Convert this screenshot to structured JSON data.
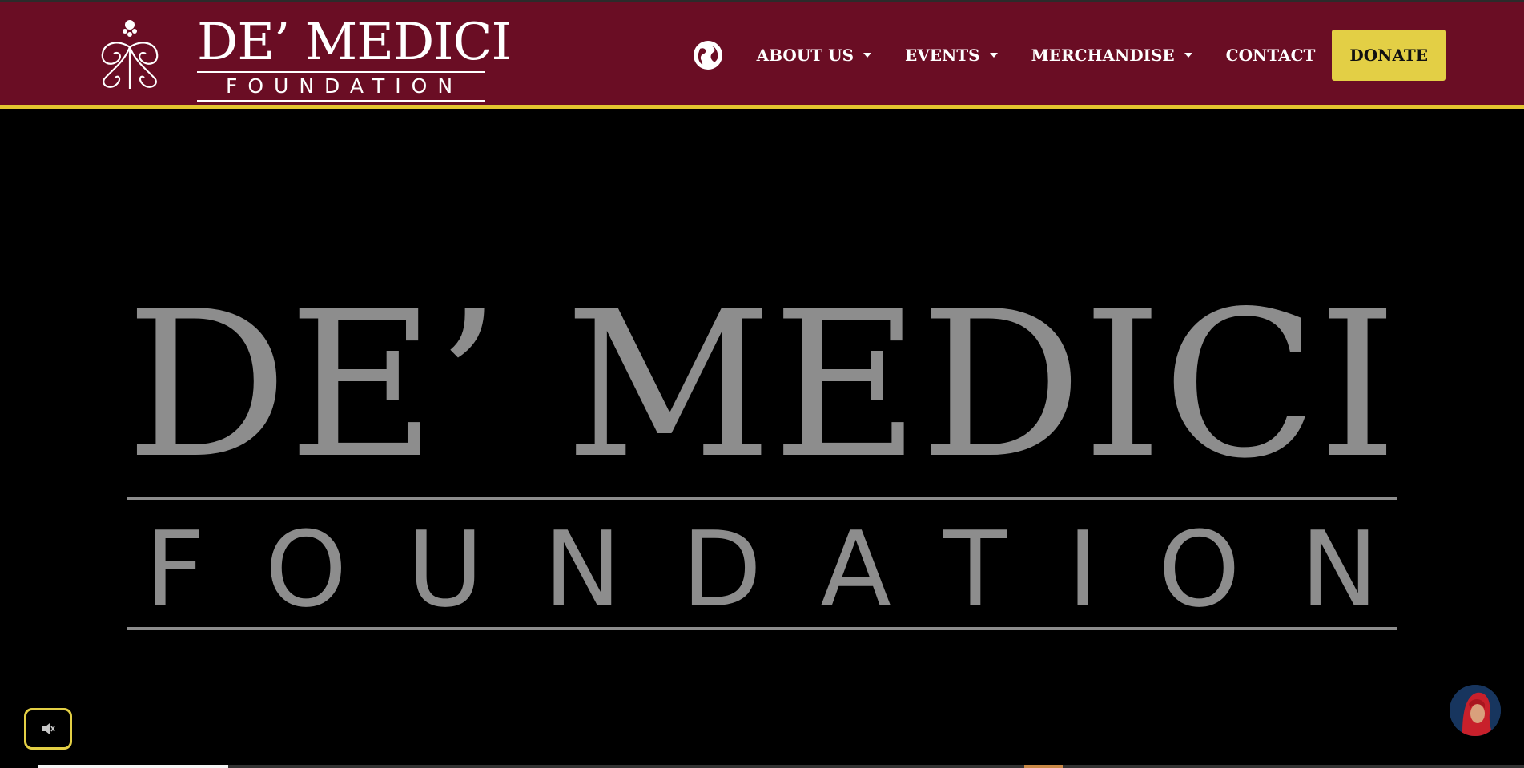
{
  "site": {
    "logo_top": "DE’ MEDICI",
    "logo_bottom": "FOUNDATION"
  },
  "nav": {
    "globe_icon": "globe-icon",
    "items": [
      {
        "label": "ABOUT US",
        "dropdown": true
      },
      {
        "label": "EVENTS",
        "dropdown": true
      },
      {
        "label": "MERCHANDISE",
        "dropdown": true
      },
      {
        "label": "CONTACT",
        "dropdown": false
      }
    ],
    "donate_label": "DONATE"
  },
  "hero": {
    "title_top": "DE’ MEDICI",
    "title_bottom": "FOUNDATION"
  },
  "video": {
    "mute_icon": "speaker-muted-icon",
    "progress_fraction": 0.128
  },
  "colors": {
    "header_bg": "#6a0d24",
    "accent_gold": "#e3c62f",
    "donate_bg": "#e3cf45",
    "hero_text": "#8d8d8d"
  },
  "chat": {
    "avatar_icon": "chat-avatar-icon"
  }
}
